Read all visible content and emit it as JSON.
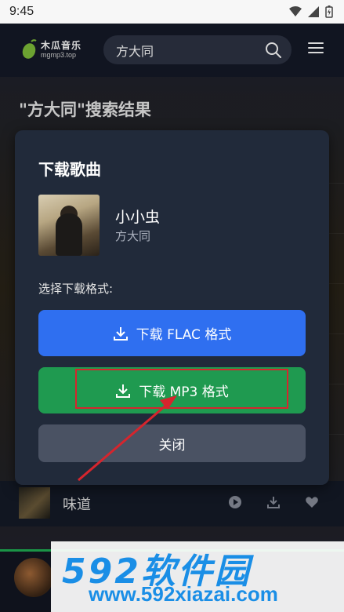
{
  "status_bar": {
    "time": "9:45"
  },
  "app": {
    "logo_cn": "木瓜音乐",
    "logo_en": "mgmp3.top",
    "search_value": "方大同",
    "results_heading": "\"方大同\"搜索结果"
  },
  "list": {
    "visible_song": "味道"
  },
  "dialog": {
    "title": "下载歌曲",
    "song_title": "小小虫",
    "artist": "方大同",
    "format_label": "选择下载格式:",
    "flac_button": "下载 FLAC 格式",
    "mp3_button": "下载 MP3 格式",
    "close_button": "关闭"
  },
  "watermark": {
    "brand": "592软件园",
    "url": "www.592xiazai.com"
  },
  "colors": {
    "flac_button": "#2f6ff0",
    "mp3_button": "#1f9a50",
    "close_button": "#4a5263",
    "highlight": "#d6252d",
    "watermark": "#1a8ee6"
  }
}
